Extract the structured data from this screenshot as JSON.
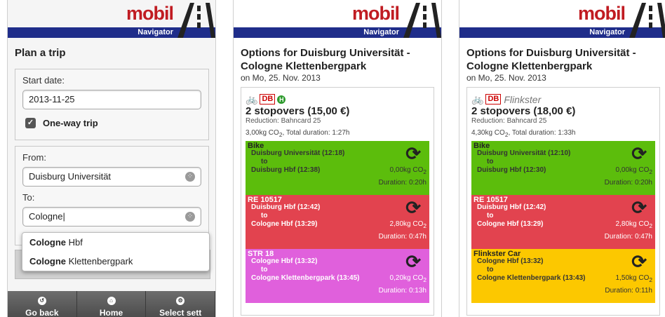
{
  "logo": {
    "word": "mobil",
    "sub": "Navigator"
  },
  "plan": {
    "title": "Plan a trip",
    "start_label": "Start date:",
    "start_value": "2013-11-25",
    "oneway_label": "One-way trip",
    "from_label": "From:",
    "from_value": "Duisburg Universität",
    "to_label": "To:",
    "to_value": "Cologne",
    "suggestions": [
      {
        "bold": "Cologne",
        "rest": " Hbf"
      },
      {
        "bold": "Cologne",
        "rest": " Klettenbergpark"
      }
    ],
    "nav": [
      "Go back",
      "Home",
      "Select sett"
    ]
  },
  "options": {
    "title": "Options for Duisburg Universität - Cologne Klettenbergpark",
    "date": "on Mo, 25. Nov. 2013"
  },
  "trip1": {
    "stopovers": "2 stopovers (15,00 €)",
    "reduction": "Reduction: Bahncard 25",
    "summary_co2": "3,00kg CO",
    "summary_rest": ", Total duration: 1:27h",
    "legs": [
      {
        "name": "Bike",
        "from": "Duisburg Universität (12:18)",
        "to": "Duisburg Hbf (12:38)",
        "co2": "0,00kg CO",
        "duration": "Duration: 0:20h",
        "color": "#5cbd0c"
      },
      {
        "name": "RE 10517",
        "from": "Duisburg Hbf (12:42)",
        "to": "Cologne Hbf (13:29)",
        "co2": "2,80kg CO",
        "duration": "Duration: 0:47h",
        "color": "#e2434f"
      },
      {
        "name": "STR 18",
        "from": "Cologne Hbf (13:32)",
        "to": "Cologne Klettenbergpark (13:45)",
        "co2": "0,20kg CO",
        "duration": "Duration: 0:13h",
        "color": "#e060dc"
      }
    ]
  },
  "trip2": {
    "provider": "Flinkster",
    "stopovers": "2 stopovers (18,00 €)",
    "reduction": "Reduction: Bahncard 25",
    "summary_co2": "4,30kg CO",
    "summary_rest": ", Total duration: 1:33h",
    "legs": [
      {
        "name": "Bike",
        "from": "Duisburg Universität (12:10)",
        "to": "Duisburg Hbf (12:30)",
        "co2": "0,00kg CO",
        "duration": "Duration: 0:20h",
        "color": "#5cbd0c"
      },
      {
        "name": "RE 10517",
        "from": "Duisburg Hbf (12:42)",
        "to": "Cologne Hbf (13:29)",
        "co2": "2,80kg CO",
        "duration": "Duration: 0:47h",
        "color": "#e2434f"
      },
      {
        "name": "Flinkster Car",
        "from": "Cologne Hbf (13:32)",
        "to": "Cologne Klettenbergpark (13:43)",
        "co2": "1,50kg CO",
        "duration": "Duration: 0:11h",
        "color": "#fcc800"
      }
    ]
  },
  "common": {
    "to_word": "to",
    "co2_sub": "2",
    "db": "DB",
    "h": "H"
  }
}
